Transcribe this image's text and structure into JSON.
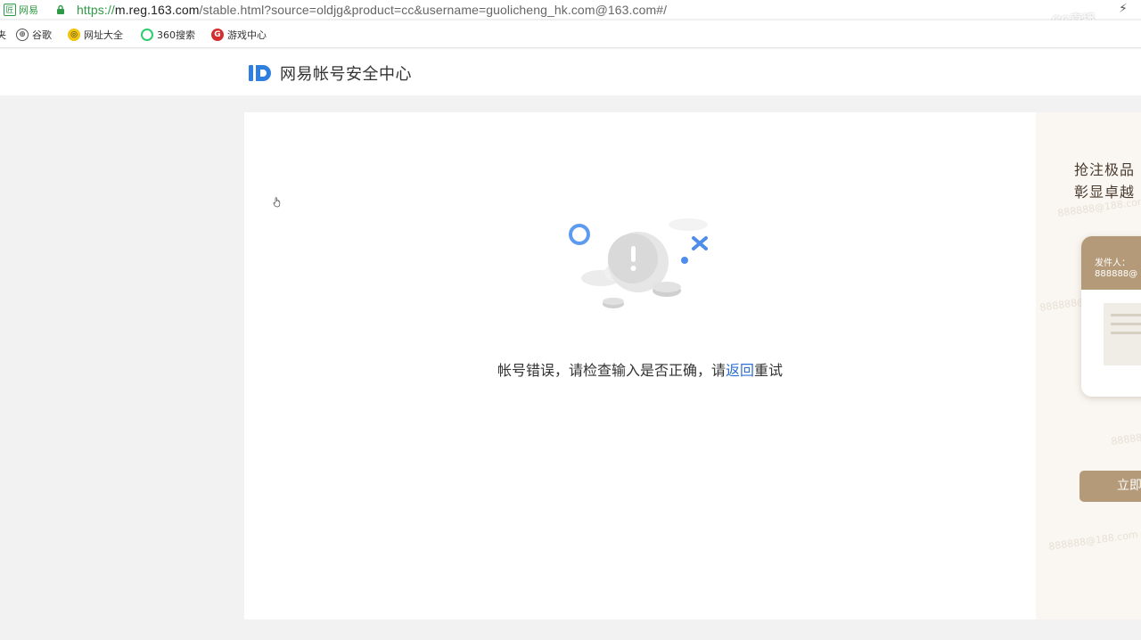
{
  "browser": {
    "tab_label": "网易",
    "url": {
      "scheme": "https://",
      "host": "m.reg.163.com",
      "path": "/stable.html?source=oldjg&product=cc&username=guolicheng_hk.com@163.com#/"
    },
    "overlay_logo": "CC直播"
  },
  "bookmarks": {
    "truncated_label": "夹",
    "items": [
      {
        "label": "谷歌",
        "icon": "globe-icon"
      },
      {
        "label": "网址大全",
        "icon": "web-directory-icon"
      },
      {
        "label": "360搜索",
        "icon": "search-360-icon"
      },
      {
        "label": "游戏中心",
        "icon": "game-center-icon"
      }
    ]
  },
  "header": {
    "logo_text": "网易帐号安全中心"
  },
  "error": {
    "message_prefix": "帐号错误，请检查输入是否正确，请",
    "link_text": "返回",
    "message_suffix": "重试"
  },
  "promo": {
    "line1": "抢注极品",
    "line2": "彰显卓越",
    "sender_label": "发件人：",
    "sender_value": "888888@",
    "button_label": "立即",
    "watermark": "888888@188.com"
  },
  "colors": {
    "accent": "#2f6fd1",
    "secure_green": "#2f9a45",
    "promo_gold": "#b49a78"
  }
}
